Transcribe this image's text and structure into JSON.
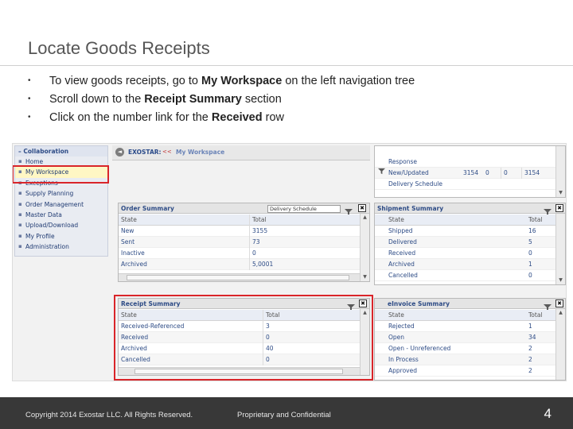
{
  "slide": {
    "title": "Locate Goods Receipts",
    "bullet_glyph": "•",
    "bullets": [
      {
        "pre": "To view goods receipts, go to ",
        "bold": "My Workspace",
        "post": " on the left navigation tree"
      },
      {
        "pre": "Scroll down to the ",
        "bold": "Receipt Summary",
        "post": " section"
      },
      {
        "pre": "Click on the number link for the ",
        "bold": "Received",
        "post": " row"
      }
    ]
  },
  "screenshot": {
    "nav": {
      "header": "– Collaboration",
      "bullet_glyph": "▪",
      "items": [
        "Home",
        "My Workspace",
        "Exceptions",
        "Supply Planning",
        "Order Management",
        "Master Data",
        "Upload/Download",
        "My Profile",
        "Administration"
      ],
      "selected": "My Workspace"
    },
    "topbar": {
      "back_glyph": "◄",
      "brand": "EXOSTAR:",
      "separator": "<<",
      "crumb": "My Workspace"
    },
    "top_right_panel": {
      "rows": [
        [
          "Response",
          "",
          "",
          ""
        ],
        [
          "New/Updated",
          "3154",
          "0",
          "0",
          "3154"
        ],
        [
          "Delivery Schedule",
          "",
          "",
          ""
        ]
      ]
    },
    "order_summary": {
      "title": "Order Summary",
      "dropdown_value": "Delivery Schedule",
      "columns": [
        "State",
        "Total"
      ],
      "rows": [
        [
          "New",
          "3155"
        ],
        [
          "Sent",
          "73"
        ],
        [
          "Inactive",
          "0"
        ],
        [
          "Archived",
          "5,0001"
        ]
      ]
    },
    "shipment_summary": {
      "title": "Shipment Summary",
      "columns": [
        "State",
        "Total"
      ],
      "rows": [
        [
          "Shipped",
          "16"
        ],
        [
          "Delivered",
          "5"
        ],
        [
          "Received",
          "0"
        ],
        [
          "Archived",
          "1"
        ],
        [
          "Cancelled",
          "0"
        ]
      ]
    },
    "receipt_summary": {
      "title": "Receipt Summary",
      "columns": [
        "State",
        "Total"
      ],
      "rows": [
        [
          "Received-Referenced",
          "3"
        ],
        [
          "Received",
          "0"
        ],
        [
          "Archived",
          "40"
        ],
        [
          "Cancelled",
          "0"
        ]
      ]
    },
    "einvoice_summary": {
      "title": "eInvoice Summary",
      "columns": [
        "State",
        "Total"
      ],
      "rows": [
        [
          "Rejected",
          "1"
        ],
        [
          "Open",
          "34"
        ],
        [
          "Open - Unreferenced",
          "2"
        ],
        [
          "In Process",
          "2"
        ],
        [
          "Approved",
          "2"
        ]
      ]
    },
    "icons": {
      "filter": "filter-icon",
      "export": "export-icon",
      "scroll_up": "▲",
      "scroll_down": "▼",
      "export_glyph": "✖"
    },
    "highlight_color": "#d9252a"
  },
  "footer": {
    "copyright": "Copyright 2014 Exostar LLC. All Rights Reserved.",
    "confidential": "Proprietary and Confidential",
    "page_number": "4"
  }
}
